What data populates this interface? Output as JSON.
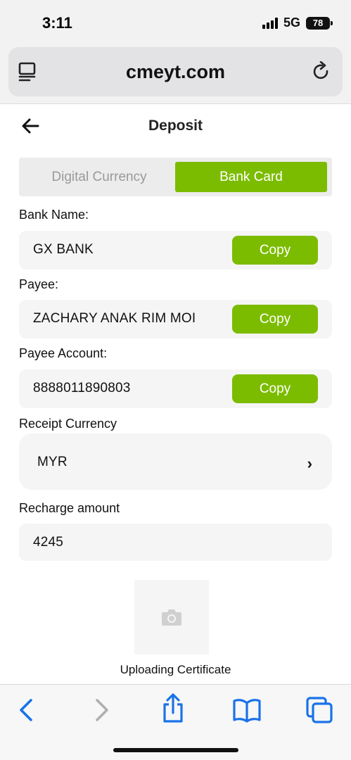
{
  "status": {
    "time": "3:11",
    "network": "5G",
    "battery": "78"
  },
  "browser": {
    "url": "cmeyt.com"
  },
  "header": {
    "title": "Deposit"
  },
  "tabs": {
    "left": "Digital Currency",
    "right": "Bank Card",
    "active": "Bank Card"
  },
  "bank": {
    "label": "Bank Name:",
    "value": "GX BANK"
  },
  "payee": {
    "label": "Payee:",
    "value": "ZACHARY ANAK RIM MOI"
  },
  "account": {
    "label": "Payee Account:",
    "value": "8888011890803"
  },
  "copy_label": "Copy",
  "currency": {
    "label": "Receipt Currency",
    "value": "MYR",
    "chevron": "›"
  },
  "amount": {
    "label": "Recharge amount",
    "value": "4245"
  },
  "upload": {
    "label": "Uploading Certificate"
  },
  "colors": {
    "accent": "#7cbc00",
    "ios_blue": "#1a73e8"
  }
}
